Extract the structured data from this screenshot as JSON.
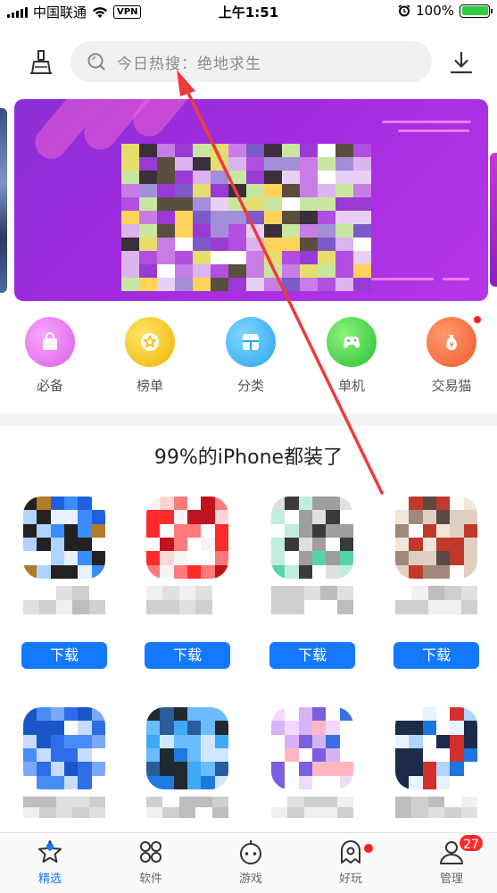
{
  "status_bar": {
    "carrier": "中国联通",
    "vpn": "VPN",
    "time": "上午1:51",
    "battery": "100%",
    "battery_level": 1.0
  },
  "header": {
    "clean_icon": "broom-icon",
    "search_placeholder": "今日热搜：绝地求生",
    "download_icon": "download-icon"
  },
  "categories": [
    {
      "label": "必备",
      "icon": "bag-icon",
      "color": "#e96ef0"
    },
    {
      "label": "榜单",
      "icon": "star-icon",
      "color": "#f5c400"
    },
    {
      "label": "分类",
      "icon": "grid-icon",
      "color": "#3cb4f5"
    },
    {
      "label": "单机",
      "icon": "gamepad-icon",
      "color": "#3ed34a"
    },
    {
      "label": "交易猫",
      "icon": "money-bag-icon",
      "color": "#f2683a"
    }
  ],
  "section": {
    "title": "99%的iPhone都装了"
  },
  "apps_row1": [
    {
      "button": "下载"
    },
    {
      "button": "下载"
    },
    {
      "button": "下载"
    },
    {
      "button": "下载"
    }
  ],
  "tabs": [
    {
      "label": "精选",
      "icon": "star-tab-icon"
    },
    {
      "label": "软件",
      "icon": "apps-tab-icon"
    },
    {
      "label": "游戏",
      "icon": "controller-tab-icon"
    },
    {
      "label": "好玩",
      "icon": "ghost-tab-icon"
    },
    {
      "label": "管理",
      "icon": "user-tab-icon",
      "badge": "27"
    }
  ],
  "colors": {
    "accent": "#1479ff",
    "badge": "#ff2a2a",
    "annotation_arrow": "#ee3b3b"
  }
}
